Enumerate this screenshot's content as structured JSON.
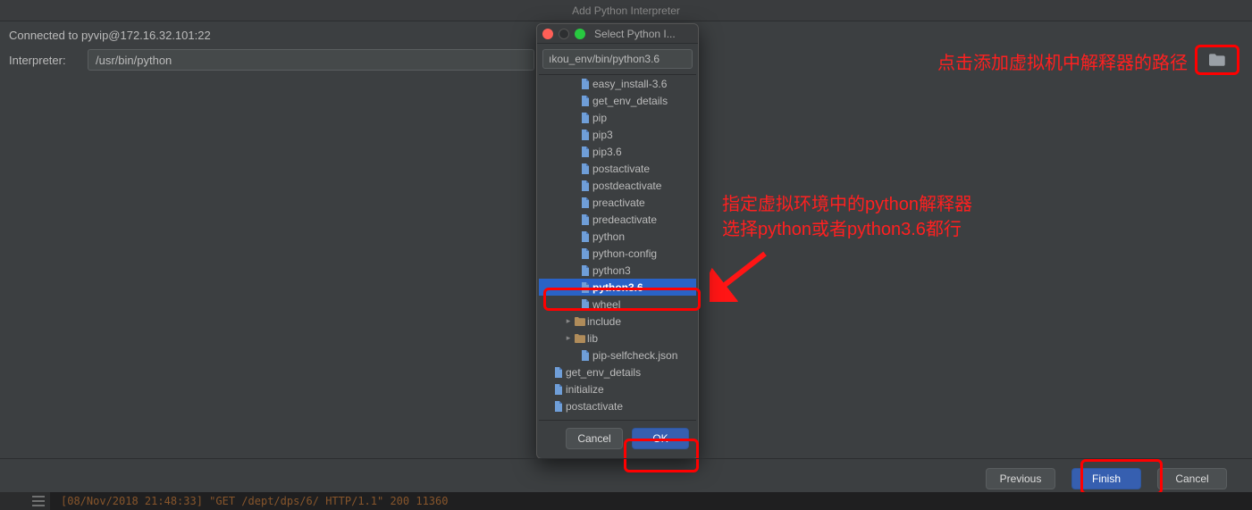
{
  "window": {
    "title": "Add Python Interpreter",
    "connected_to": "Connected to pyvip@172.16.32.101:22",
    "interpreter_label": "Interpreter:",
    "interpreter_path": "/usr/bin/python",
    "buttons": {
      "previous": "Previous",
      "finish": "Finish",
      "cancel": "Cancel"
    }
  },
  "chooser": {
    "title": "Select Python I...",
    "path": "ıkou_env/bin/python3.6",
    "items": [
      {
        "label": "easy_install-3.6",
        "type": "file",
        "indent": 1
      },
      {
        "label": "get_env_details",
        "type": "file",
        "indent": 1
      },
      {
        "label": "pip",
        "type": "file",
        "indent": 1
      },
      {
        "label": "pip3",
        "type": "file",
        "indent": 1
      },
      {
        "label": "pip3.6",
        "type": "file",
        "indent": 1
      },
      {
        "label": "postactivate",
        "type": "file",
        "indent": 1
      },
      {
        "label": "postdeactivate",
        "type": "file",
        "indent": 1
      },
      {
        "label": "preactivate",
        "type": "file",
        "indent": 1
      },
      {
        "label": "predeactivate",
        "type": "file",
        "indent": 1
      },
      {
        "label": "python",
        "type": "file",
        "indent": 1
      },
      {
        "label": "python-config",
        "type": "file",
        "indent": 1
      },
      {
        "label": "python3",
        "type": "file",
        "indent": 1
      },
      {
        "label": "python3.6",
        "type": "file",
        "indent": 1,
        "selected": true
      },
      {
        "label": "wheel",
        "type": "file",
        "indent": 1
      },
      {
        "label": "include",
        "type": "folder",
        "indent": 0,
        "expando": "▸"
      },
      {
        "label": "lib",
        "type": "folder",
        "indent": 0,
        "expando": "▸"
      },
      {
        "label": "pip-selfcheck.json",
        "type": "file",
        "indent": 1
      },
      {
        "label": "get_env_details",
        "type": "file",
        "indent": -1
      },
      {
        "label": "initialize",
        "type": "file",
        "indent": -1
      },
      {
        "label": "postactivate",
        "type": "file",
        "indent": -1
      }
    ],
    "buttons": {
      "cancel": "Cancel",
      "ok": "OK"
    }
  },
  "annotations": {
    "top": "点击添加虚拟机中解释器的路径",
    "mid_line1": "指定虚拟环境中的python解释器",
    "mid_line2": "选择python或者python3.6都行"
  },
  "terminal": {
    "line": "[08/Nov/2018 21:48:33] \"GET /dept/dps/6/ HTTP/1.1\" 200 11360"
  }
}
